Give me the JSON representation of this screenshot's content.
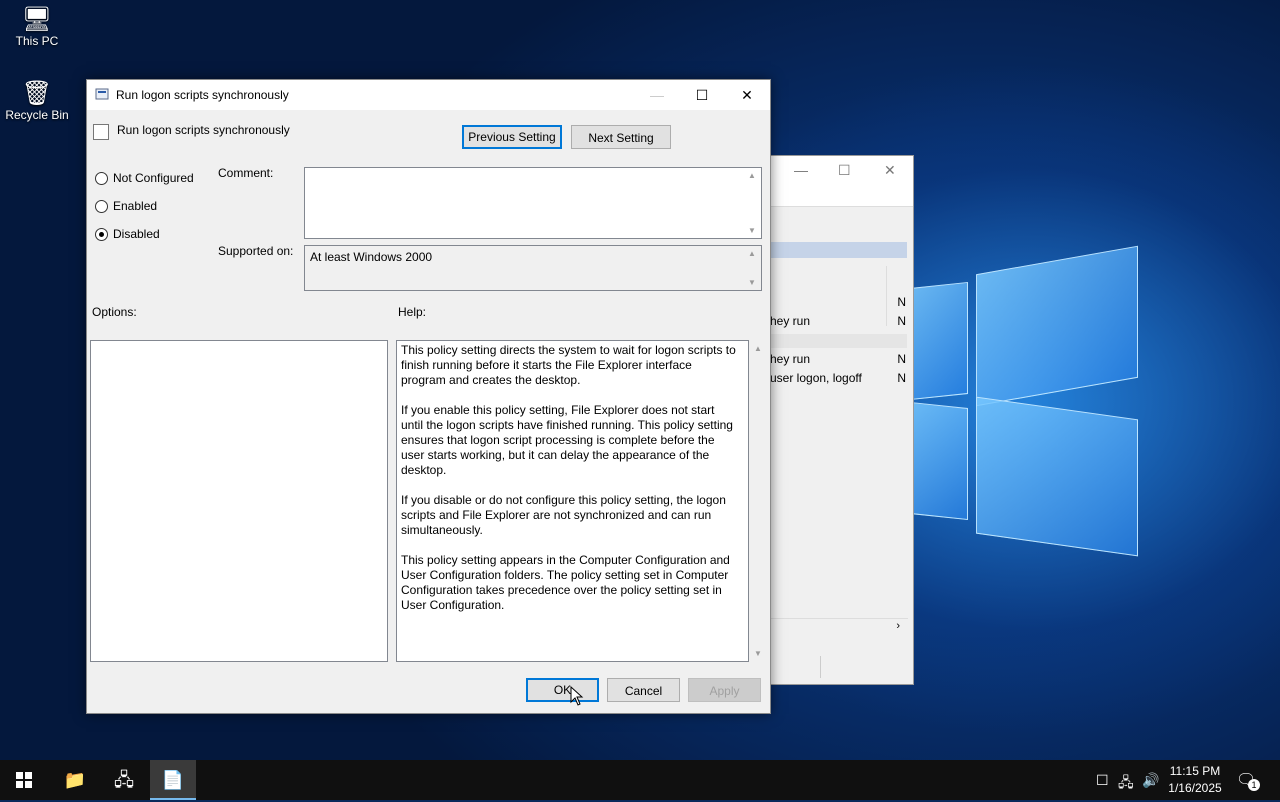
{
  "desktop": {
    "icons": [
      {
        "label": "This PC",
        "icon": "computer-icon"
      },
      {
        "label": "Recycle Bin",
        "icon": "recycle-bin-icon"
      }
    ]
  },
  "background_window": {
    "rows": [
      {
        "text": "",
        "flag": "N"
      },
      {
        "text": "hey run",
        "flag": "N"
      },
      {
        "text": "hey run",
        "flag": "N"
      },
      {
        "text": "user logon, logoff",
        "flag": "N"
      }
    ]
  },
  "dialog": {
    "window_title": "Run logon scripts synchronously",
    "policy_name": "Run logon scripts synchronously",
    "buttons": {
      "previous": "Previous Setting",
      "next": "Next Setting",
      "ok": "OK",
      "cancel": "Cancel",
      "apply": "Apply"
    },
    "state_options": [
      {
        "label": "Not Configured",
        "selected": false
      },
      {
        "label": "Enabled",
        "selected": false
      },
      {
        "label": "Disabled",
        "selected": true
      }
    ],
    "comment_label": "Comment:",
    "comment_value": "",
    "supported_label": "Supported on:",
    "supported_value": "At least Windows 2000",
    "options_label": "Options:",
    "help_label": "Help:",
    "help_paragraphs": [
      "This policy setting directs the system to wait for logon scripts to finish running before it starts the File Explorer interface program and creates the desktop.",
      "If you enable this policy setting, File Explorer does not start until the logon scripts have finished running. This policy setting ensures that logon script processing is complete before the user starts working, but it can delay the appearance of the desktop.",
      "If you disable or do not configure this policy setting, the logon scripts and File Explorer are not synchronized and can run simultaneously.",
      "This policy setting appears in the Computer Configuration and User Configuration folders. The policy setting set in Computer Configuration takes precedence over the policy setting set in User Configuration."
    ]
  },
  "taskbar": {
    "clock_time": "11:15 PM",
    "clock_date": "1/16/2025",
    "notification_count": "1"
  }
}
